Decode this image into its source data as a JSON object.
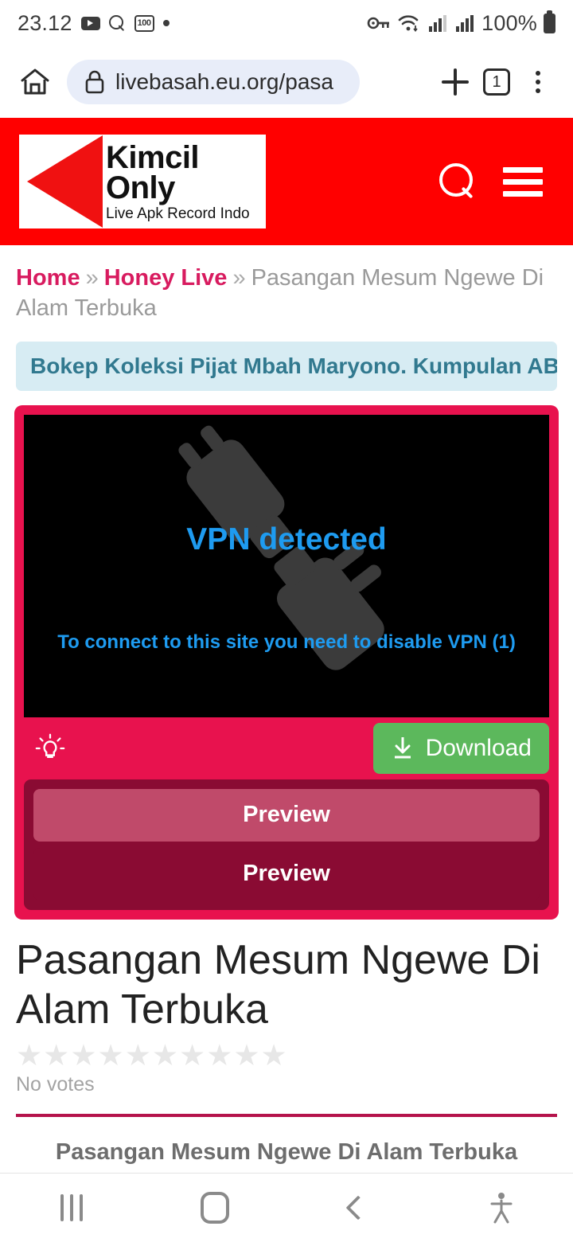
{
  "status_bar": {
    "time": "23.12",
    "battery_percent": "100%",
    "badge_label": "100",
    "icons": [
      "youtube-icon",
      "search-icon",
      "battery-saver-badge-icon",
      "dot-icon",
      "vpn-key-icon",
      "wifi-icon",
      "signal-bars-icon",
      "signal-bars-2-icon",
      "battery-icon"
    ]
  },
  "browser_bar": {
    "url": "livebasah.eu.org/pasa",
    "tab_count": "1",
    "icons": [
      "home-icon",
      "lock-icon",
      "new-tab-icon",
      "tab-switcher-icon",
      "overflow-menu-icon"
    ]
  },
  "site_header": {
    "logo_line1": "Kimcil",
    "logo_line2": "Only",
    "logo_tagline": "Live Apk Record Indo",
    "background_color": "#FF0000",
    "icons": [
      "search-icon",
      "hamburger-menu-icon"
    ]
  },
  "breadcrumb": {
    "home": "Home",
    "category": "Honey Live",
    "separator": "»",
    "current": "Pasangan Mesum Ngewe Di Alam Terbuka"
  },
  "notice": {
    "text": "Bokep Koleksi Pijat Mbah Maryono. Kumpulan ABG N",
    "background_color": "#d7ecf3",
    "text_color": "#31798f"
  },
  "player": {
    "vpn_title": "VPN detected",
    "vpn_subtitle": "To connect to this site you need to disable VPN (1)",
    "vpn_text_color": "#1E9BF0",
    "card_color": "#E8124E",
    "download_label": "Download",
    "download_color": "#5CB85C",
    "preview_1_label": "Preview",
    "preview_2_label": "Preview",
    "icons": [
      "lightbulb-icon",
      "download-icon",
      "unplugged-plug-icon"
    ]
  },
  "article": {
    "title": "Pasangan Mesum Ngewe Di Alam Terbuka",
    "star_count": 10,
    "star_glyph": "★",
    "votes_text": "No votes",
    "sub_heading": "Pasangan Mesum Ngewe Di Alam Terbuka",
    "rule_color": "#B5134B"
  },
  "nav_bar": {
    "icons": [
      "recents-icon",
      "home-icon",
      "back-icon",
      "accessibility-icon"
    ]
  }
}
